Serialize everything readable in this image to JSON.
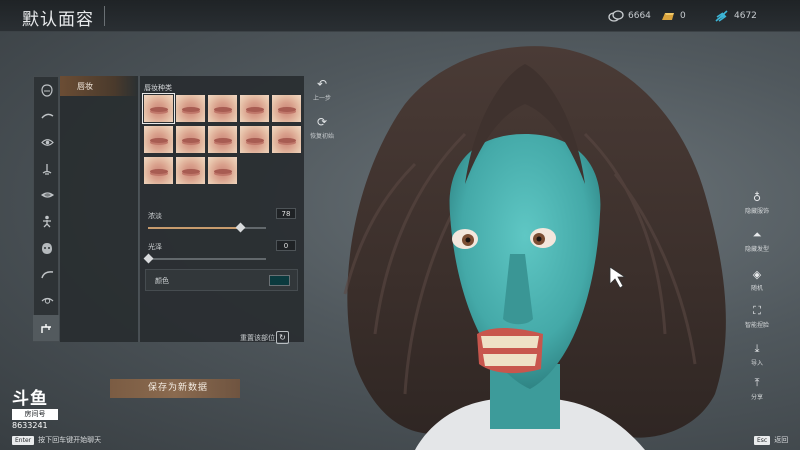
{
  "header": {
    "title": "默认面容"
  },
  "currencies": [
    {
      "icon": "silver-coin-icon",
      "value": "6664"
    },
    {
      "icon": "gold-bar-icon",
      "value": "0"
    },
    {
      "icon": "feather-icon",
      "value": "4672"
    }
  ],
  "category_icons": [
    "head-shape-icon",
    "eyebrow-icon",
    "eye-icon",
    "nose-icon",
    "mouth-icon",
    "body-icon",
    "face-mask-icon",
    "brow-arc-icon",
    "ear-icon",
    "makeup-brush-icon"
  ],
  "submenu": {
    "active_label": "唇妆"
  },
  "panel": {
    "section_title": "唇妆种类",
    "swatch_count": 13,
    "selected_swatch": 1,
    "sliders": [
      {
        "label": "浓淡",
        "value": "78",
        "fraction": 0.78
      },
      {
        "label": "光泽",
        "value": "0",
        "fraction": 0.0
      }
    ],
    "color_label": "颜色",
    "color_value": "#0b3a3e",
    "reset_part_label": "重置该部位"
  },
  "actions": {
    "undo_label": "上一步",
    "reset_label": "恢复初始"
  },
  "save_button": "保存为新数据",
  "right_tools": [
    {
      "icon": "hide-clothes-icon",
      "label": "隐藏服饰"
    },
    {
      "icon": "hide-hair-icon",
      "label": "隐藏发型"
    },
    {
      "icon": "random-dice-icon",
      "label": "随机"
    },
    {
      "icon": "smart-photo-icon",
      "label": "智能捏脸"
    },
    {
      "icon": "import-icon",
      "label": "导入"
    },
    {
      "icon": "share-icon",
      "label": "分享"
    }
  ],
  "watermark": {
    "logo": "斗鱼",
    "tag": "房间号",
    "room": "8633241"
  },
  "chat_hint": {
    "key": "Enter",
    "text": "按下回车键开始聊天"
  },
  "esc_hint": {
    "key": "Esc",
    "text": "返回"
  }
}
